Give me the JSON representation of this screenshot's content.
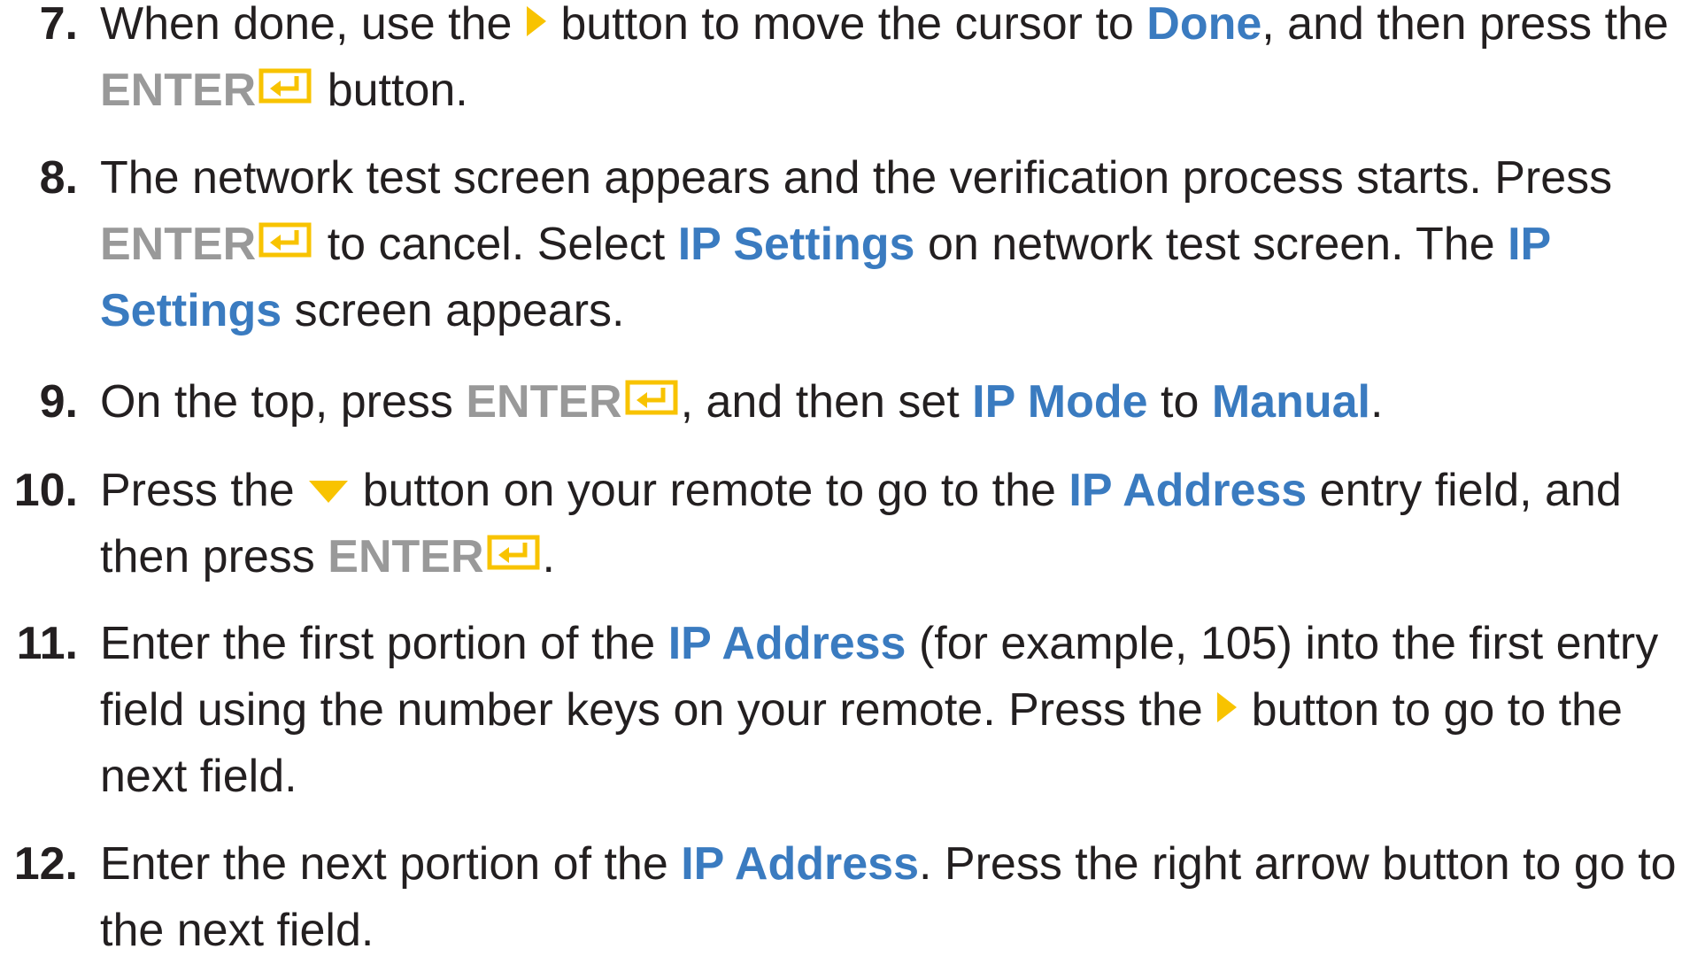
{
  "colors": {
    "link_blue": "#3a7bc0",
    "enter_gray": "#999999",
    "icon_yellow": "#f8c300",
    "text": "#231f20"
  },
  "icons": {
    "right_arrow": "right-arrow-icon",
    "down_arrow": "down-arrow-icon",
    "enter": "enter-icon"
  },
  "steps": {
    "s7": {
      "num": "7.",
      "t1": "When done, use the",
      "t2": "button to move the cursor to",
      "done": "Done",
      "t3": ", and then press the",
      "enter": "ENTER",
      "t4": "button."
    },
    "s8": {
      "num": "8.",
      "t1": "The network test screen appears and the verification process starts. Press",
      "enter": "ENTER",
      "t2": "to cancel. Select",
      "ip_settings": "IP Settings",
      "t3": "on network test screen. The",
      "ip": "IP",
      "settings": "Settings",
      "t4": "screen appears."
    },
    "s9": {
      "num": "9.",
      "t1": "On the top, press",
      "enter": "ENTER",
      "t2": ", and then set",
      "ip_mode": "IP Mode",
      "t3": "to",
      "manual": "Manual",
      "t4": "."
    },
    "s10": {
      "num": "10.",
      "t1": "Press the",
      "t2": "button on your remote to go to the",
      "ip_address": "IP Address",
      "t3": "entry field, and",
      "t4": "then press",
      "enter": "ENTER",
      "t5": "."
    },
    "s11": {
      "num": "11.",
      "t1": "Enter the first portion of the",
      "ip_address": "IP Address",
      "t2": "(for example, 105) into the first entry",
      "t3": "field using the number keys on your remote. Press the",
      "t4": "button to go to the",
      "t5": "next field."
    },
    "s12": {
      "num": "12.",
      "t1": "Enter the next portion of the",
      "ip_address": "IP Address",
      "t2": ". Press the right arrow button to go to",
      "t3": "the next field."
    }
  }
}
